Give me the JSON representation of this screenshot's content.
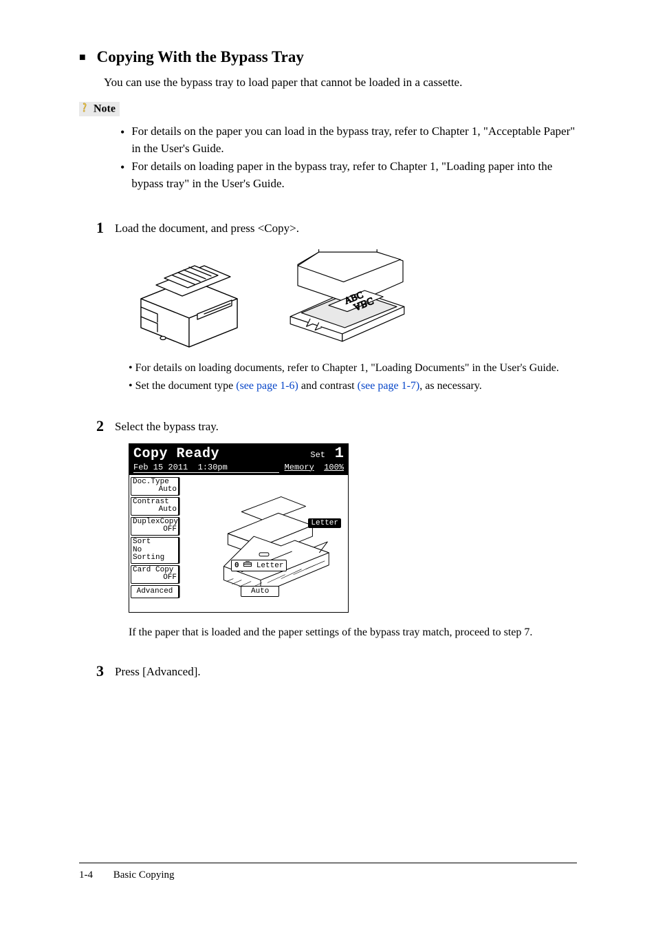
{
  "section": {
    "title": "Copying With the Bypass Tray",
    "intro": "You can use the bypass tray to load paper that cannot be loaded in a cassette."
  },
  "note": {
    "label": "Note",
    "items": [
      "For details on the paper you can load in the bypass tray, refer to Chapter 1, \"Acceptable Paper\" in the User's Guide.",
      "For details on loading paper in the bypass tray, refer to Chapter 1, \"Loading paper into the bypass tray\" in the User's Guide."
    ]
  },
  "steps": {
    "s1": {
      "num": "1",
      "text": "Load the document, and press <Copy>.",
      "sub": [
        "For details on loading documents, refer to Chapter 1, \"Loading Documents\" in the User's Guide."
      ],
      "sub2_prefix": "Set the document type ",
      "sub2_link1": "(see page 1-6)",
      "sub2_mid": " and contrast ",
      "sub2_link2": "(see page 1-7)",
      "sub2_suffix": ", as necessary."
    },
    "s2": {
      "num": "2",
      "text": "Select the bypass tray.",
      "after": "If the paper that is loaded and the paper settings of the bypass tray match, proceed to step 7."
    },
    "s3": {
      "num": "3",
      "text": "Press [Advanced]."
    }
  },
  "lcd": {
    "title": "Copy Ready",
    "set_label": "Set",
    "set_num": "1",
    "date": "Feb 15 2011",
    "time": "1:30pm",
    "mem_label": "Memory",
    "mem_val": "100%",
    "buttons": {
      "b1_l1": "Doc.Type",
      "b1_l2": "Auto",
      "b2_l1": "Contrast",
      "b2_l2": "Auto",
      "b3_l1": "DuplexCopy",
      "b3_l2": "OFF",
      "b4_l1": "Sort",
      "b4_l2": "No Sorting",
      "b5_l1": "Card Copy",
      "b5_l2": "OFF",
      "b6_l1": "Advanced"
    },
    "paper_size": "Letter",
    "tray_prefix": "0",
    "tray_letter": "Letter",
    "tray_auto": "Auto"
  },
  "footer": {
    "page_num": "1-4",
    "section": "Basic Copying"
  }
}
